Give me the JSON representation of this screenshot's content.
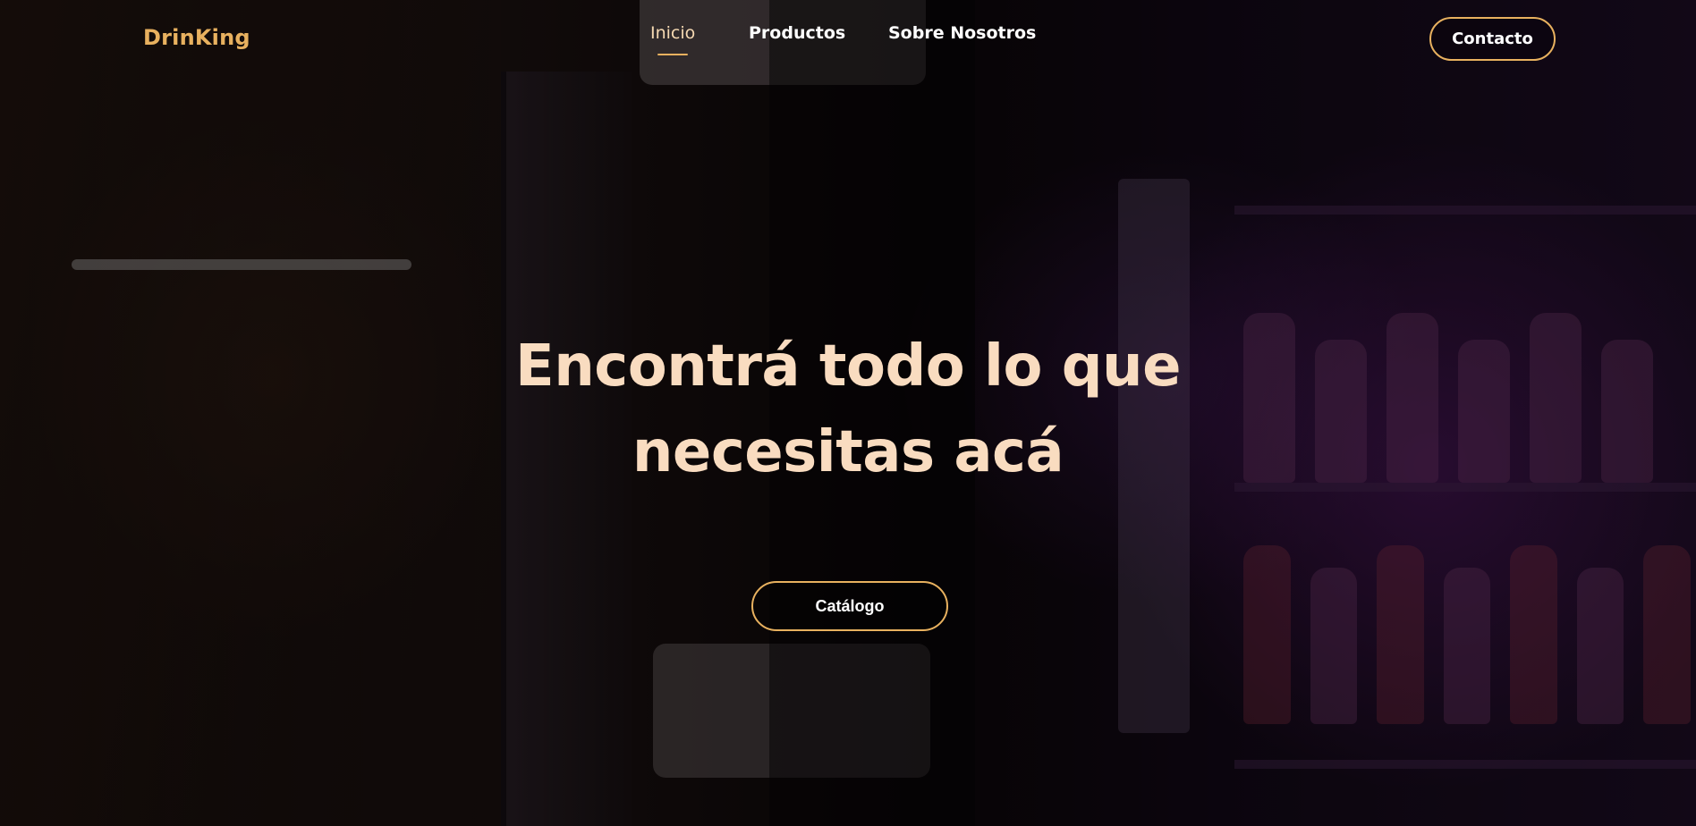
{
  "header": {
    "logo": "DrinKing",
    "nav": [
      {
        "label": "Inicio",
        "active": true
      },
      {
        "label": "Productos",
        "active": false
      },
      {
        "label": "Sobre Nosotros",
        "active": false
      }
    ],
    "contact_label": "Contacto"
  },
  "hero": {
    "headline": "Encontrá todo lo que necesitas acá",
    "cta_label": "Catálogo"
  },
  "colors": {
    "accent": "#e8b15f",
    "headline": "#f9dcc0",
    "text": "#ffffff"
  }
}
